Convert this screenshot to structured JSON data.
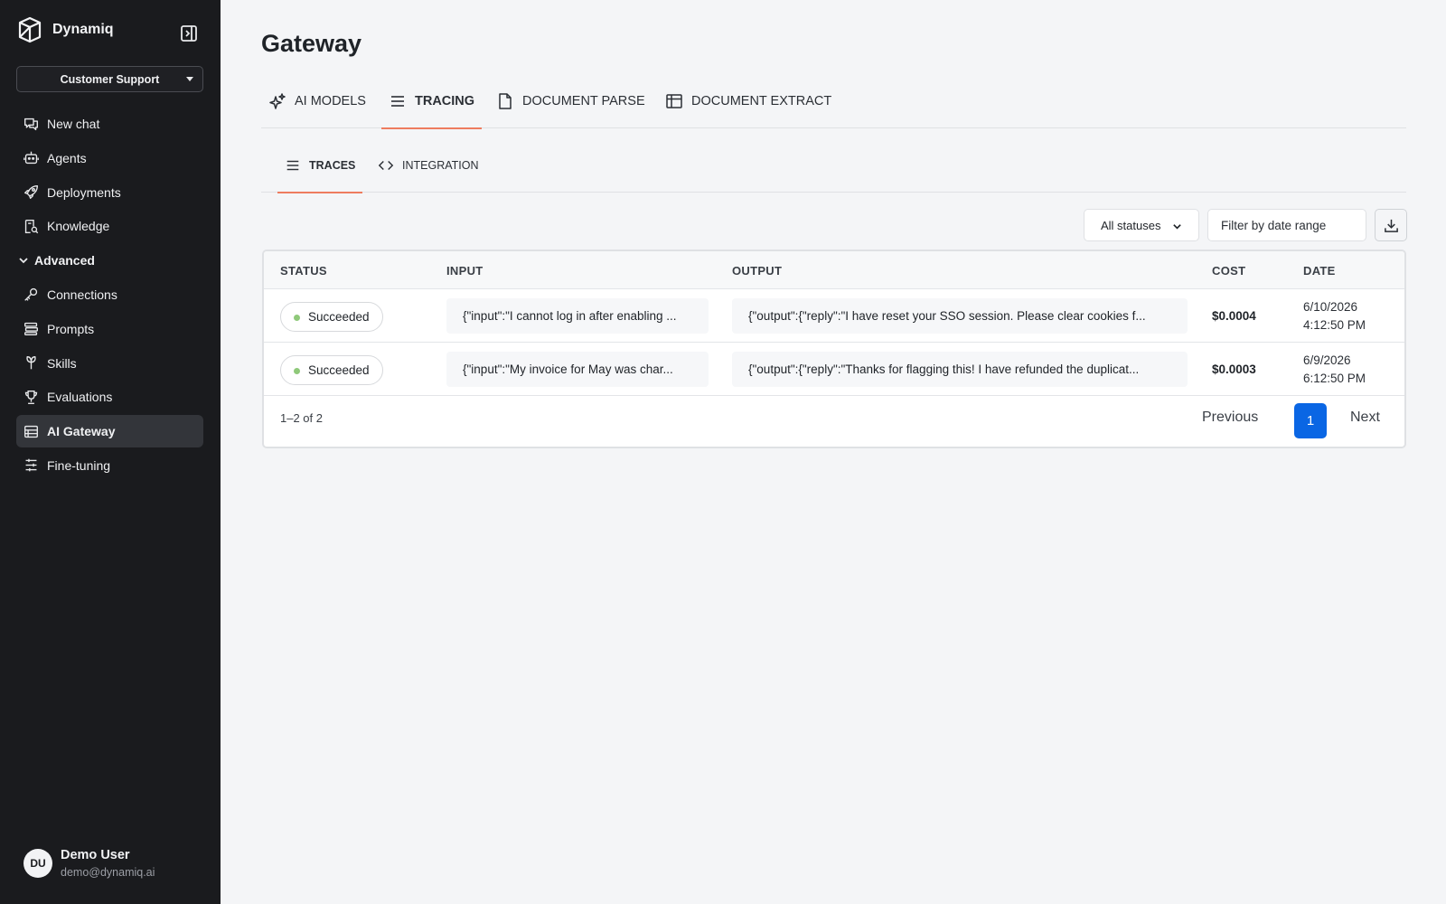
{
  "sidebar": {
    "brand": "Dynamiq",
    "workspace": "Customer Support",
    "items": [
      {
        "label": "New chat",
        "icon": "chat-icon"
      },
      {
        "label": "Agents",
        "icon": "agent-icon"
      },
      {
        "label": "Deployments",
        "icon": "rocket-icon"
      },
      {
        "label": "Knowledge",
        "icon": "knowledge-icon"
      }
    ],
    "advanced_label": "Advanced",
    "advanced_items": [
      {
        "label": "Connections",
        "icon": "key-icon"
      },
      {
        "label": "Prompts",
        "icon": "prompts-icon"
      },
      {
        "label": "Skills",
        "icon": "skills-icon"
      },
      {
        "label": "Evaluations",
        "icon": "trophy-icon"
      },
      {
        "label": "AI Gateway",
        "icon": "gateway-icon",
        "active": true
      },
      {
        "label": "Fine-tuning",
        "icon": "sliders-icon"
      }
    ],
    "user": {
      "initials": "DU",
      "name": "Demo User",
      "email": "demo@dynamiq.ai"
    }
  },
  "page": {
    "title": "Gateway"
  },
  "tabs": [
    {
      "label": "AI MODELS",
      "icon": "sparkle-icon"
    },
    {
      "label": "TRACING",
      "icon": "list-icon",
      "active": true
    },
    {
      "label": "DOCUMENT PARSE",
      "icon": "document-icon"
    },
    {
      "label": "DOCUMENT EXTRACT",
      "icon": "table-icon"
    }
  ],
  "subtabs": [
    {
      "label": "TRACES",
      "icon": "list-icon",
      "active": true
    },
    {
      "label": "INTEGRATION",
      "icon": "code-icon"
    }
  ],
  "filters": {
    "status": "All statuses",
    "date_placeholder": "Filter by date range"
  },
  "table": {
    "columns": [
      "STATUS",
      "INPUT",
      "OUTPUT",
      "COST",
      "DATE"
    ],
    "rows": [
      {
        "status": "Succeeded",
        "input": "{\"input\":\"I cannot log in after enabling ...",
        "output": "{\"output\":{\"reply\":\"I have reset your SSO session. Please clear cookies f...",
        "cost": "$0.0004",
        "date": "6/10/2026",
        "time": "4:12:50 PM"
      },
      {
        "status": "Succeeded",
        "input": "{\"input\":\"My invoice for May was char...",
        "output": "{\"output\":{\"reply\":\"Thanks for flagging this! I have refunded the duplicat...",
        "cost": "$0.0003",
        "date": "6/9/2026",
        "time": "6:12:50 PM"
      }
    ]
  },
  "pagination": {
    "summary": "1–2 of 2",
    "previous": "Previous",
    "current": "1",
    "next": "Next"
  },
  "colors": {
    "accent": "#ee7c5f",
    "primary": "#0a66e4",
    "success": "#8fc97a",
    "sidebar_bg": "#1a1b1e"
  }
}
